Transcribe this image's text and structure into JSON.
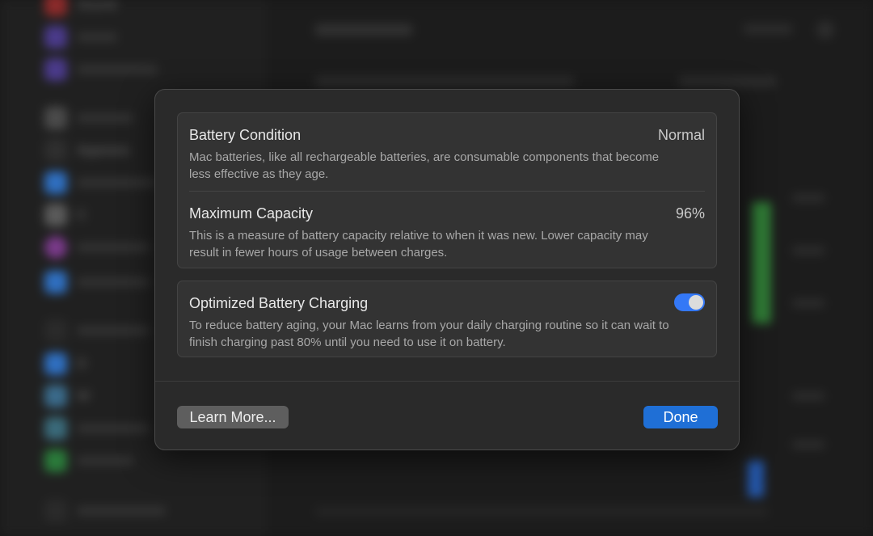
{
  "background": {
    "sidebar_items": [
      "Sound",
      "",
      "",
      "",
      "Appeara",
      "",
      "C",
      "",
      "",
      "",
      "D",
      "W",
      "",
      "",
      ""
    ],
    "sidebar_icon_colors": [
      "#8a2a2a",
      "#4a3a8a",
      "#4a3a8a",
      "#4a4a4a",
      "#3a3a3a",
      "#2f6fc0",
      "#5a5a5a",
      "#7a3a8a",
      "#2f6fc0",
      "#3a3a3a",
      "#2f6fc0",
      "#2f6fc0",
      "#3a6a7a",
      "#2a7a3a",
      "#3a3a3a"
    ]
  },
  "dialog": {
    "battery_condition": {
      "title": "Battery Condition",
      "value": "Normal",
      "description": "Mac batteries, like all rechargeable batteries, are consumable components that become less effective as they age."
    },
    "maximum_capacity": {
      "title": "Maximum Capacity",
      "value": "96%",
      "description": "This is a measure of battery capacity relative to when it was new. Lower capacity may result in fewer hours of usage between charges."
    },
    "optimized_charging": {
      "title": "Optimized Battery Charging",
      "enabled": true,
      "description": "To reduce battery aging, your Mac learns from your daily charging routine so it can wait to finish charging past 80% until you need to use it on battery."
    },
    "learn_more_label": "Learn More...",
    "done_label": "Done"
  },
  "colors": {
    "accent": "#1f6fd6",
    "toggle_on": "#3478f6"
  }
}
